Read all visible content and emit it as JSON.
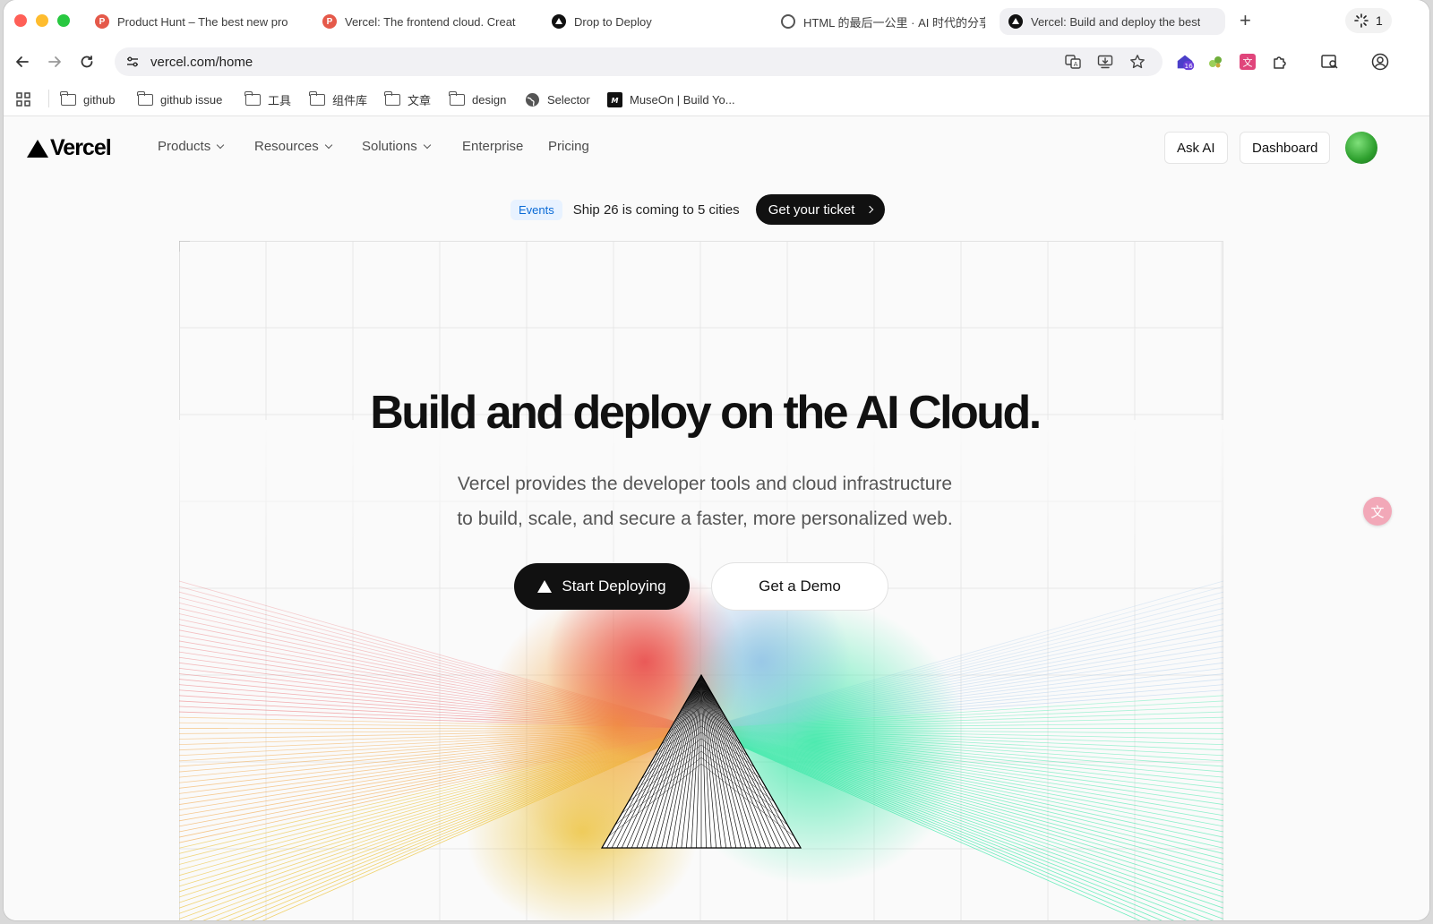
{
  "browser": {
    "tabs": [
      {
        "title": "Product Hunt – The best new pro",
        "favicon": "product-hunt-icon"
      },
      {
        "title": "Vercel: The frontend cloud. Creat",
        "favicon": "product-hunt-icon"
      },
      {
        "title": "Drop to Deploy",
        "favicon": "vercel-icon"
      },
      {
        "title": "HTML 的最后一公里 · AI 时代的分享",
        "favicon": "globe-icon"
      },
      {
        "title": "Vercel: Build and deploy the best",
        "favicon": "vercel-icon",
        "active": true
      }
    ],
    "new_tab": "+",
    "extension_badge_count": "1",
    "url": "vercel.com/home",
    "extension_count_badge": "16",
    "bookmarks": [
      {
        "label": "github",
        "icon": "folder-icon"
      },
      {
        "label": "github issue",
        "icon": "folder-icon"
      },
      {
        "label": "工具",
        "icon": "folder-icon"
      },
      {
        "label": "组件库",
        "icon": "folder-icon"
      },
      {
        "label": "文章",
        "icon": "folder-icon"
      },
      {
        "label": "design",
        "icon": "folder-icon"
      },
      {
        "label": "Selector",
        "icon": "globe-icon"
      },
      {
        "label": "MuseOn | Build Yo...",
        "icon": "museon-icon"
      }
    ]
  },
  "site": {
    "logo": "Vercel",
    "nav": {
      "products": "Products",
      "resources": "Resources",
      "solutions": "Solutions",
      "enterprise": "Enterprise",
      "pricing": "Pricing"
    },
    "ask_ai": "Ask AI",
    "dashboard": "Dashboard",
    "banner": {
      "tag": "Events",
      "text": "Ship 26 is coming to 5 cities",
      "cta": "Get your ticket"
    },
    "hero": {
      "title": "Build and deploy on the AI Cloud.",
      "subtitle_line1": "Vercel provides the developer tools and cloud infrastructure",
      "subtitle_line2": "to build, scale, and secure a faster, more personalized web.",
      "primary_cta": "Start Deploying",
      "secondary_cta": "Get a Demo"
    }
  },
  "colors": {
    "accent_dark": "#111111",
    "events_blue": "#0a6ad6",
    "ray_red": "#e8444a",
    "ray_orange": "#f2a13a",
    "ray_yellow": "#ecc33a",
    "ray_green": "#3ce8a8",
    "ray_blue": "#8fbde8"
  }
}
